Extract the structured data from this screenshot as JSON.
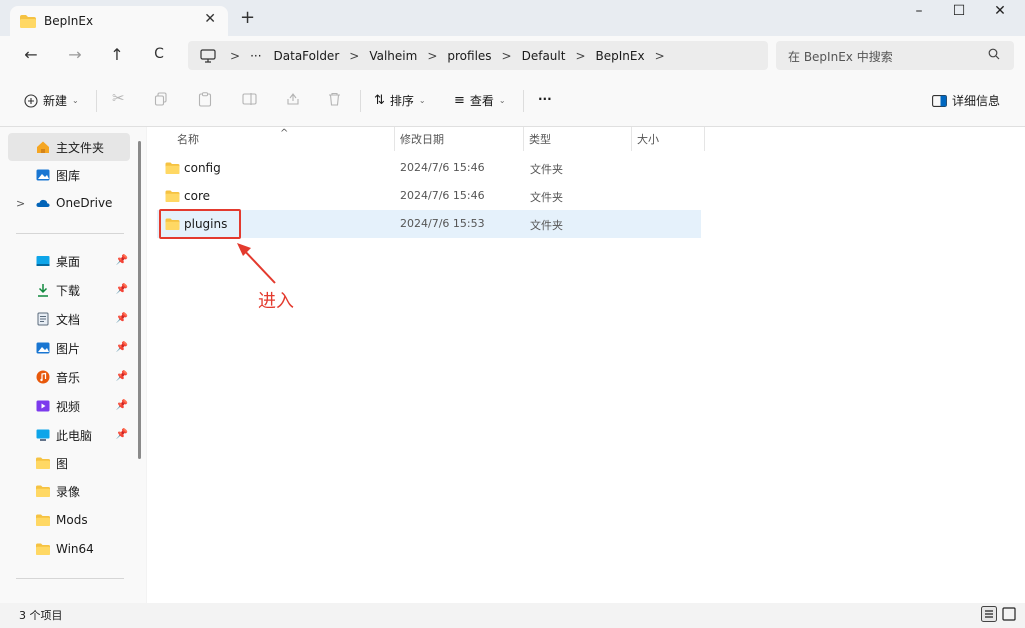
{
  "window": {
    "tab_title": "BepInEx",
    "minimize": "–",
    "maximize": "☐",
    "close": "✕"
  },
  "nav": {
    "back": "←",
    "forward": "→",
    "up": "↑",
    "refresh": "C",
    "breadcrumbs": [
      "DataFolder",
      "Valheim",
      "profiles",
      "Default",
      "BepInEx"
    ],
    "more": "···",
    "search_placeholder": "在 BepInEx 中搜索"
  },
  "toolbar": {
    "new_label": "新建",
    "sort_label": "排序",
    "view_label": "查看",
    "more_label": "···",
    "details_label": "详细信息"
  },
  "sidebar": {
    "top": [
      {
        "label": "主文件夹",
        "icon": "home-icon"
      },
      {
        "label": "图库",
        "icon": "gallery-icon"
      },
      {
        "label": "OneDrive",
        "icon": "cloud-icon"
      }
    ],
    "quick": [
      {
        "label": "桌面",
        "icon": "desktop-icon",
        "pinned": true
      },
      {
        "label": "下载",
        "icon": "download-icon",
        "pinned": true
      },
      {
        "label": "文档",
        "icon": "document-icon",
        "pinned": true
      },
      {
        "label": "图片",
        "icon": "pictures-icon",
        "pinned": true
      },
      {
        "label": "音乐",
        "icon": "music-icon",
        "pinned": true
      },
      {
        "label": "视频",
        "icon": "video-icon",
        "pinned": true
      },
      {
        "label": "此电脑",
        "icon": "computer-icon",
        "pinned": true
      },
      {
        "label": "图",
        "icon": "folder-icon",
        "pinned": false
      },
      {
        "label": "录像",
        "icon": "folder-icon",
        "pinned": false
      },
      {
        "label": "Mods",
        "icon": "folder-icon",
        "pinned": false
      },
      {
        "label": "Win64",
        "icon": "folder-icon",
        "pinned": false
      }
    ]
  },
  "columns": {
    "name": "名称",
    "date": "修改日期",
    "type": "类型",
    "size": "大小"
  },
  "files": [
    {
      "name": "config",
      "date": "2024/7/6 15:46",
      "type": "文件夹"
    },
    {
      "name": "core",
      "date": "2024/7/6 15:46",
      "type": "文件夹"
    },
    {
      "name": "plugins",
      "date": "2024/7/6 15:53",
      "type": "文件夹"
    }
  ],
  "annotation": "进入",
  "status": {
    "count": "3 个项目"
  },
  "colors": {
    "accent": "#0067c0",
    "folder": "#f5c242",
    "annotation": "#e33a2e",
    "selected_row": "#e5f1fb"
  }
}
